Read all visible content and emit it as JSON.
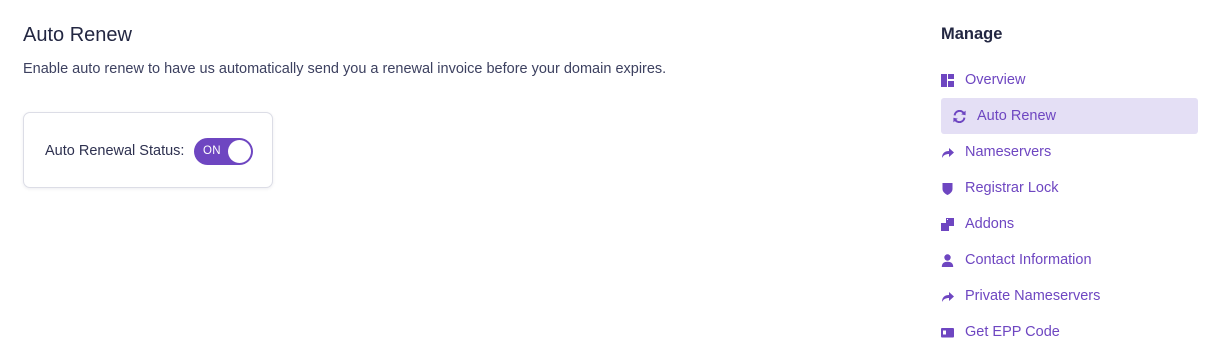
{
  "main": {
    "title": "Auto Renew",
    "description": "Enable auto renew to have us automatically send you a renewal invoice before your domain expires.",
    "status_label": "Auto Renewal Status:",
    "toggle_text": "ON",
    "toggle_on": true
  },
  "sidebar": {
    "title": "Manage",
    "items": [
      {
        "label": "Overview",
        "icon": "overview-icon",
        "active": false
      },
      {
        "label": "Auto Renew",
        "icon": "refresh-icon",
        "active": true
      },
      {
        "label": "Nameservers",
        "icon": "share-arrow-icon",
        "active": false
      },
      {
        "label": "Registrar Lock",
        "icon": "shield-icon",
        "active": false
      },
      {
        "label": "Addons",
        "icon": "addons-icon",
        "active": false
      },
      {
        "label": "Contact Information",
        "icon": "user-icon",
        "active": false
      },
      {
        "label": "Private Nameservers",
        "icon": "share-arrow-icon",
        "active": false
      },
      {
        "label": "Get EPP Code",
        "icon": "id-card-icon",
        "active": false
      }
    ]
  },
  "colors": {
    "accent": "#6e46c1",
    "active_background": "#e4dff5"
  }
}
